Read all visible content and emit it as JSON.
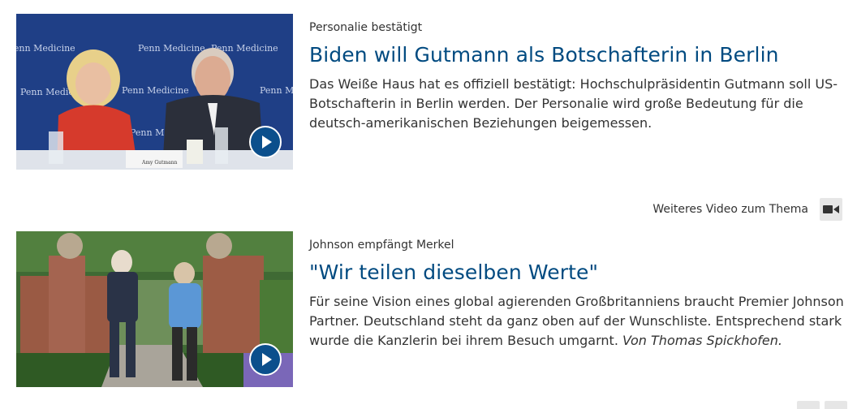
{
  "teasers": [
    {
      "dachzeile": "Personalie bestätigt",
      "headline": "Biden will Gutmann als Botschafterin in Berlin",
      "text": "Das Weiße Haus hat es offiziell bestätigt: Hochschulpräsidentin Gutmann soll US-Botschafterin in Berlin werden. Der Personalie wird große Bedeutung für die deutsch-amerikanischen Beziehungen beigemessen.",
      "author": "",
      "image_alt": "Amy Gutmann und Joe Biden bei einer Veranstaltung von Penn Medicine",
      "backdrop_text": "Penn Medicine",
      "nameplate_text": "Amy Gutmann",
      "play_icon": "play-icon"
    },
    {
      "dachzeile": "Johnson empfängt Merkel",
      "headline": "\"Wir teilen dieselben Werte\"",
      "text": "Für seine Vision eines global agierenden Großbritanniens braucht Premier Johnson Partner. Deutschland steht da ganz oben auf der Wunschliste. Entsprechend stark wurde die Kanzlerin bei ihrem Besuch umgarnt.",
      "author": "Von Thomas Spickhofen.",
      "image_alt": "Boris Johnson und Angela Merkel im Garten von Chequers",
      "play_icon": "play-icon"
    }
  ],
  "related": {
    "label": "Weiteres Video zum Thema",
    "icon": "video-camera-icon"
  },
  "colors": {
    "headline": "#004a80",
    "play_button": "#0b4f8c",
    "icon_button_bg": "#e6e6e6"
  }
}
